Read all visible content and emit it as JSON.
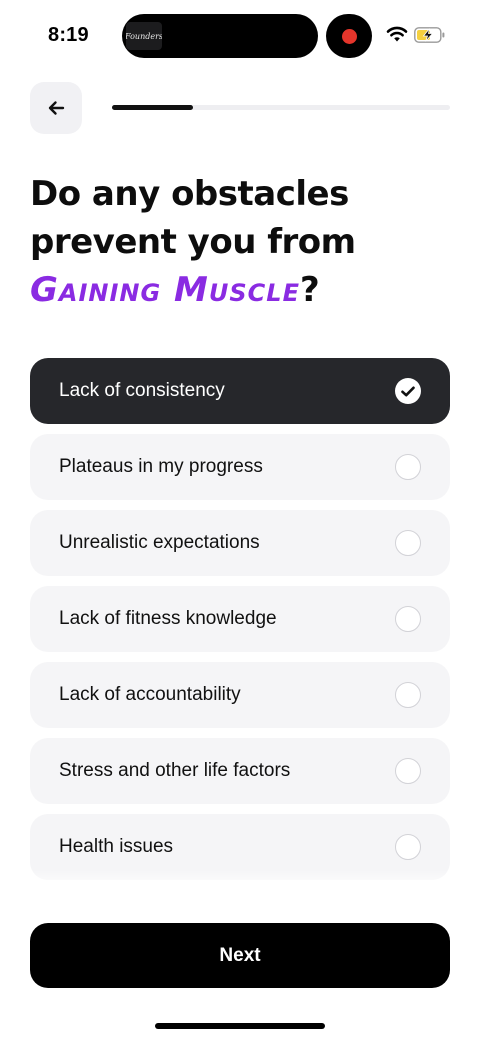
{
  "status_bar": {
    "time": "8:19",
    "island_thumbnail_text": "Founders",
    "recording_color": "#e5352b",
    "wifi_icon": "wifi-icon",
    "battery_icon": "battery-charging-icon",
    "battery_color": "#f4d03f"
  },
  "header": {
    "back_icon": "arrow-left-icon",
    "progress_fraction": 0.24
  },
  "heading": {
    "line1": "Do any obstacles",
    "line2": "prevent you from",
    "accent": "Gaining Muscle",
    "suffix": "?",
    "accent_color": "#8a2be2"
  },
  "options": [
    {
      "label": "Lack of consistency",
      "selected": true
    },
    {
      "label": "Plateaus in my progress",
      "selected": false
    },
    {
      "label": "Unrealistic expectations",
      "selected": false
    },
    {
      "label": "Lack of fitness knowledge",
      "selected": false
    },
    {
      "label": "Lack of accountability",
      "selected": false
    },
    {
      "label": "Stress and other life factors",
      "selected": false
    },
    {
      "label": "Health issues",
      "selected": false
    }
  ],
  "next_button": {
    "label": "Next"
  }
}
